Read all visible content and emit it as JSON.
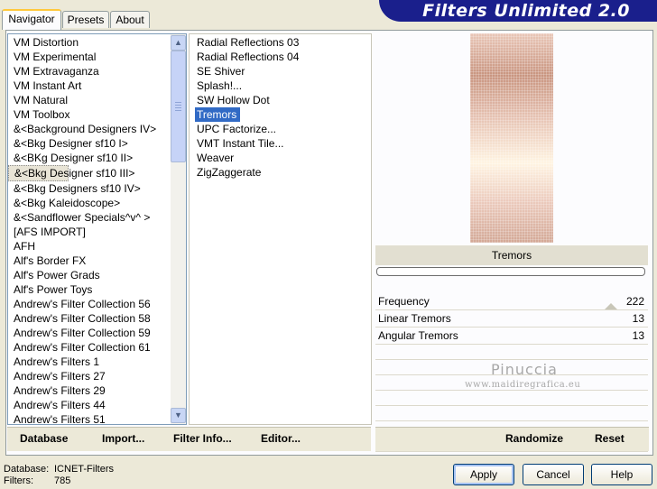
{
  "tabs": [
    {
      "label": "Navigator",
      "active": true
    },
    {
      "label": "Presets",
      "active": false
    },
    {
      "label": "About",
      "active": false
    }
  ],
  "app_title": "Filters Unlimited 2.0",
  "categories": [
    "VM Distortion",
    "VM Experimental",
    "VM Extravaganza",
    "VM Instant Art",
    "VM Natural",
    "VM Toolbox",
    "&<Background Designers IV>",
    "&<Bkg Designer sf10 I>",
    "&<BKg Designer sf10 II>",
    "&<Bkg Designer sf10 III>",
    "&<Bkg Designers sf10 IV>",
    "&<Bkg Kaleidoscope>",
    "&<Sandflower Specials^v^ >",
    "[AFS IMPORT]",
    "AFH",
    "Alf's Border FX",
    "Alf's Power Grads",
    "Alf's Power Toys",
    "Andrew's Filter Collection 56",
    "Andrew's Filter Collection 58",
    "Andrew's Filter Collection 59",
    "Andrew's Filter Collection 61",
    "Andrew's Filters 1",
    "Andrew's Filters 27",
    "Andrew's Filters 29",
    "Andrew's Filters 44",
    "Andrew's Filters 51"
  ],
  "selected_category": "&<Bkg Designer sf10 III>",
  "filters": [
    "Radial Reflections 03",
    "Radial Reflections 04",
    "SE Shiver",
    "Splash!...",
    "SW Hollow Dot",
    "Tremors",
    "UPC Factorize...",
    "VMT Instant Tile...",
    "Weaver",
    "ZigZaggerate"
  ],
  "selected_filter": "Tremors",
  "preview_filter_name": "Tremors",
  "params": [
    {
      "label": "Frequency",
      "value": "222"
    },
    {
      "label": "Linear Tremors",
      "value": "13"
    },
    {
      "label": "Angular Tremors",
      "value": "13"
    }
  ],
  "watermark": {
    "name": "Pinuccia",
    "url": "www.maidiregrafica.eu"
  },
  "left_strip": {
    "database": "Database",
    "import": "Import...",
    "filter_info": "Filter Info...",
    "editor": "Editor..."
  },
  "right_strip": {
    "randomize": "Randomize",
    "reset": "Reset"
  },
  "status": {
    "database_label": "Database:",
    "database_value": "ICNET-Filters",
    "filters_label": "Filters:",
    "filters_value": "785"
  },
  "buttons": {
    "apply": "Apply",
    "cancel": "Cancel",
    "help": "Help"
  },
  "colors": {
    "banner": "#1a1f8c",
    "selection": "#316ac5",
    "window": "#ece9d8"
  }
}
